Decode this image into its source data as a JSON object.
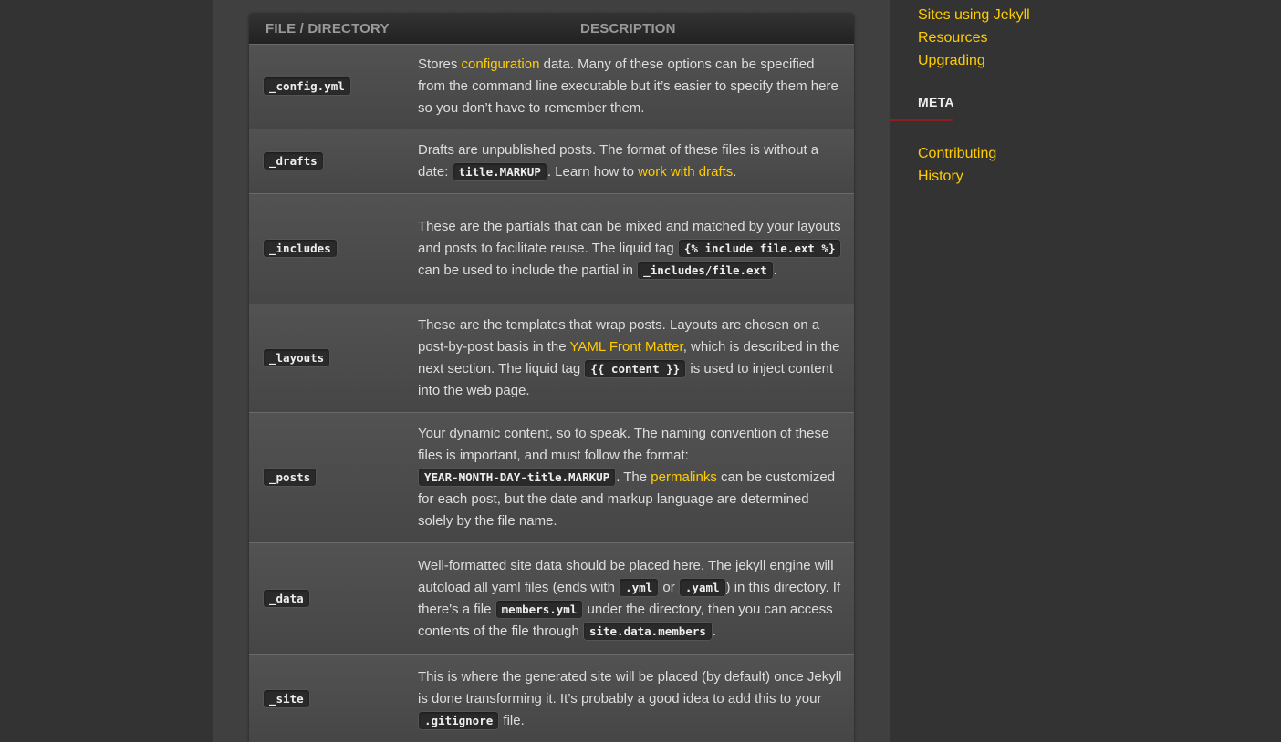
{
  "table": {
    "header": {
      "file": "FILE / DIRECTORY",
      "description": "DESCRIPTION"
    },
    "rows": [
      {
        "file": "_config.yml",
        "desc": {
          "t1": "Stores ",
          "link1": "configuration",
          "t2": " data. Many of these options can be specified from the command line executable but it’s easier to specify them here so you don’t have to remember them."
        }
      },
      {
        "file": "_drafts",
        "desc": {
          "t1": "Drafts are unpublished posts. The format of these files is without a date: ",
          "code1": "title.MARKUP",
          "t2": ". Learn how to ",
          "link1": "work with drafts",
          "t3": "."
        }
      },
      {
        "file": "_includes",
        "desc": {
          "t1": "These are the partials that can be mixed and matched by your layouts and posts to facilitate reuse. The liquid tag ",
          "code1": "{% include file.ext %}",
          "t2": " can be used to include the partial in ",
          "code2": "_includes/file.ext",
          "t3": "."
        }
      },
      {
        "file": "_layouts",
        "desc": {
          "t1": "These are the templates that wrap posts. Layouts are chosen on a post-by-post basis in the ",
          "link1": "YAML Front Matter",
          "t2": ", which is described in the next section. The liquid tag ",
          "code1": "{{ content }}",
          "t3": " is used to inject content into the web page."
        }
      },
      {
        "file": "_posts",
        "desc": {
          "t1": "Your dynamic content, so to speak. The naming convention of these files is important, and must follow the format: ",
          "code1": "YEAR-MONTH-DAY-title.MARKUP",
          "t2": ". The ",
          "link1": "permalinks",
          "t3": " can be customized for each post, but the date and markup language are determined solely by the file name."
        }
      },
      {
        "file": "_data",
        "desc": {
          "t1": "Well-formatted site data should be placed here. The jekyll engine will autoload all yaml files (ends with ",
          "code1": ".yml",
          "t2": " or ",
          "code2": ".yaml",
          "t3": ") in this directory. If there's a file ",
          "code3": "members.yml",
          "t4": " under the directory, then you can access contents of the file through ",
          "code4": "site.data.members",
          "t5": "."
        }
      },
      {
        "file": "_site",
        "desc": {
          "t1": "This is where the generated site will be placed (by default) once Jekyll is done transforming it. It’s probably a good idea to add this to your ",
          "code1": ".gitignore",
          "t2": " file."
        }
      }
    ]
  },
  "sidebar": {
    "links_top": [
      "Sites using Jekyll",
      "Resources",
      "Upgrading"
    ],
    "meta_title": "META",
    "meta_links": [
      "Contributing",
      "History"
    ]
  },
  "colors": {
    "link": "#ffcc00",
    "background": "#333333",
    "content": "#404040",
    "meta_underline": "#8b1e1e"
  }
}
